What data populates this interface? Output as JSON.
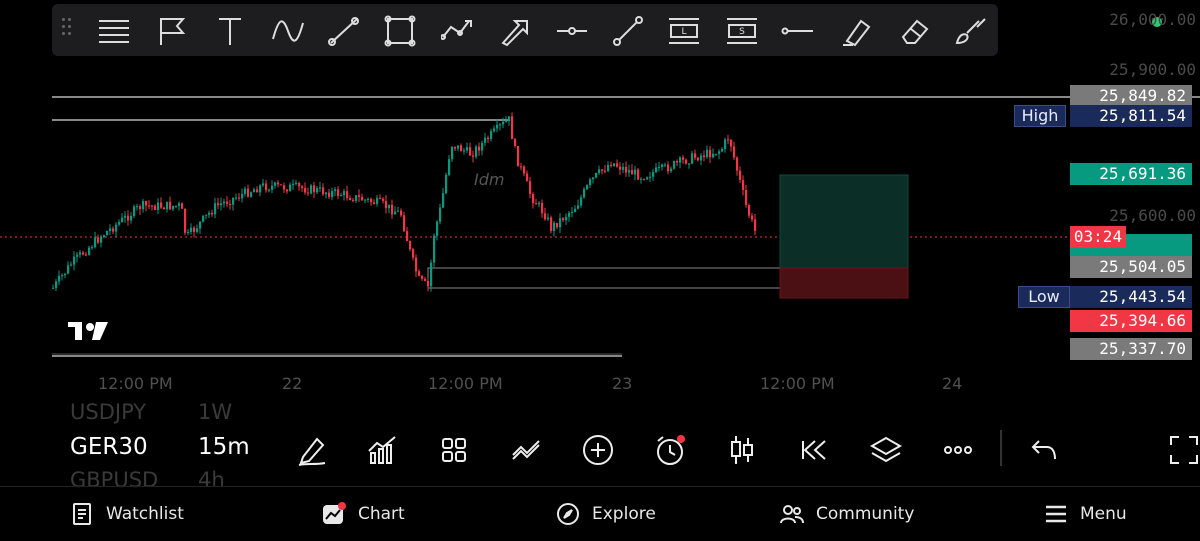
{
  "colors": {
    "background": "#000000",
    "bull": "#089981",
    "bear": "#f23645",
    "badge_blue": "#1a2a5a",
    "gray_label": "#7a7a7a",
    "target_zone": "#0b2e27",
    "stop_zone": "#4a1014"
  },
  "toolbar": {
    "icons": [
      "drag-handle-icon",
      "lines-menu-icon",
      "flag-icon",
      "text-tool-icon",
      "curve-icon",
      "arrow-tool-icon",
      "rectangle-tool-icon",
      "path-tool-icon",
      "arrow-marker-icon",
      "horizontal-ray-icon",
      "trend-line-icon",
      "long-position-icon",
      "short-position-icon",
      "horizontal-line-icon",
      "highlighter-icon",
      "eraser-icon",
      "brush-icon"
    ]
  },
  "price_axis": {
    "ticks": [
      "26,000.00",
      "25,900.00",
      "25,600.00"
    ],
    "labels": [
      {
        "text": "25,849.82",
        "kind": "gray"
      },
      {
        "text": "25,811.54",
        "kind": "blue"
      },
      {
        "text": "25,691.36",
        "kind": "green"
      },
      {
        "text": "03:24",
        "kind": "red"
      },
      {
        "text": "25,504.05",
        "kind": "gray"
      },
      {
        "text": "25,443.54",
        "kind": "blue"
      },
      {
        "text": "25,394.66",
        "kind": "red"
      },
      {
        "text": "25,337.70",
        "kind": "gray"
      }
    ],
    "high_badge": "High",
    "low_badge": "Low"
  },
  "time_axis": [
    "12:00 PM",
    "22",
    "12:00 PM",
    "23",
    "12:00 PM",
    "24"
  ],
  "chart": {
    "annotation": "Idm",
    "status_dot_color": "#2ecc71"
  },
  "symbol_panel": {
    "symbol_prev": "USDJPY",
    "timeframe_prev": "1W",
    "symbol": "GER30",
    "timeframe": "15m",
    "symbol_next": "GBPUSD",
    "timeframe_next": "4h"
  },
  "bottom_nav": {
    "watchlist": "Watchlist",
    "chart": "Chart",
    "explore": "Explore",
    "community": "Community",
    "menu": "Menu"
  }
}
